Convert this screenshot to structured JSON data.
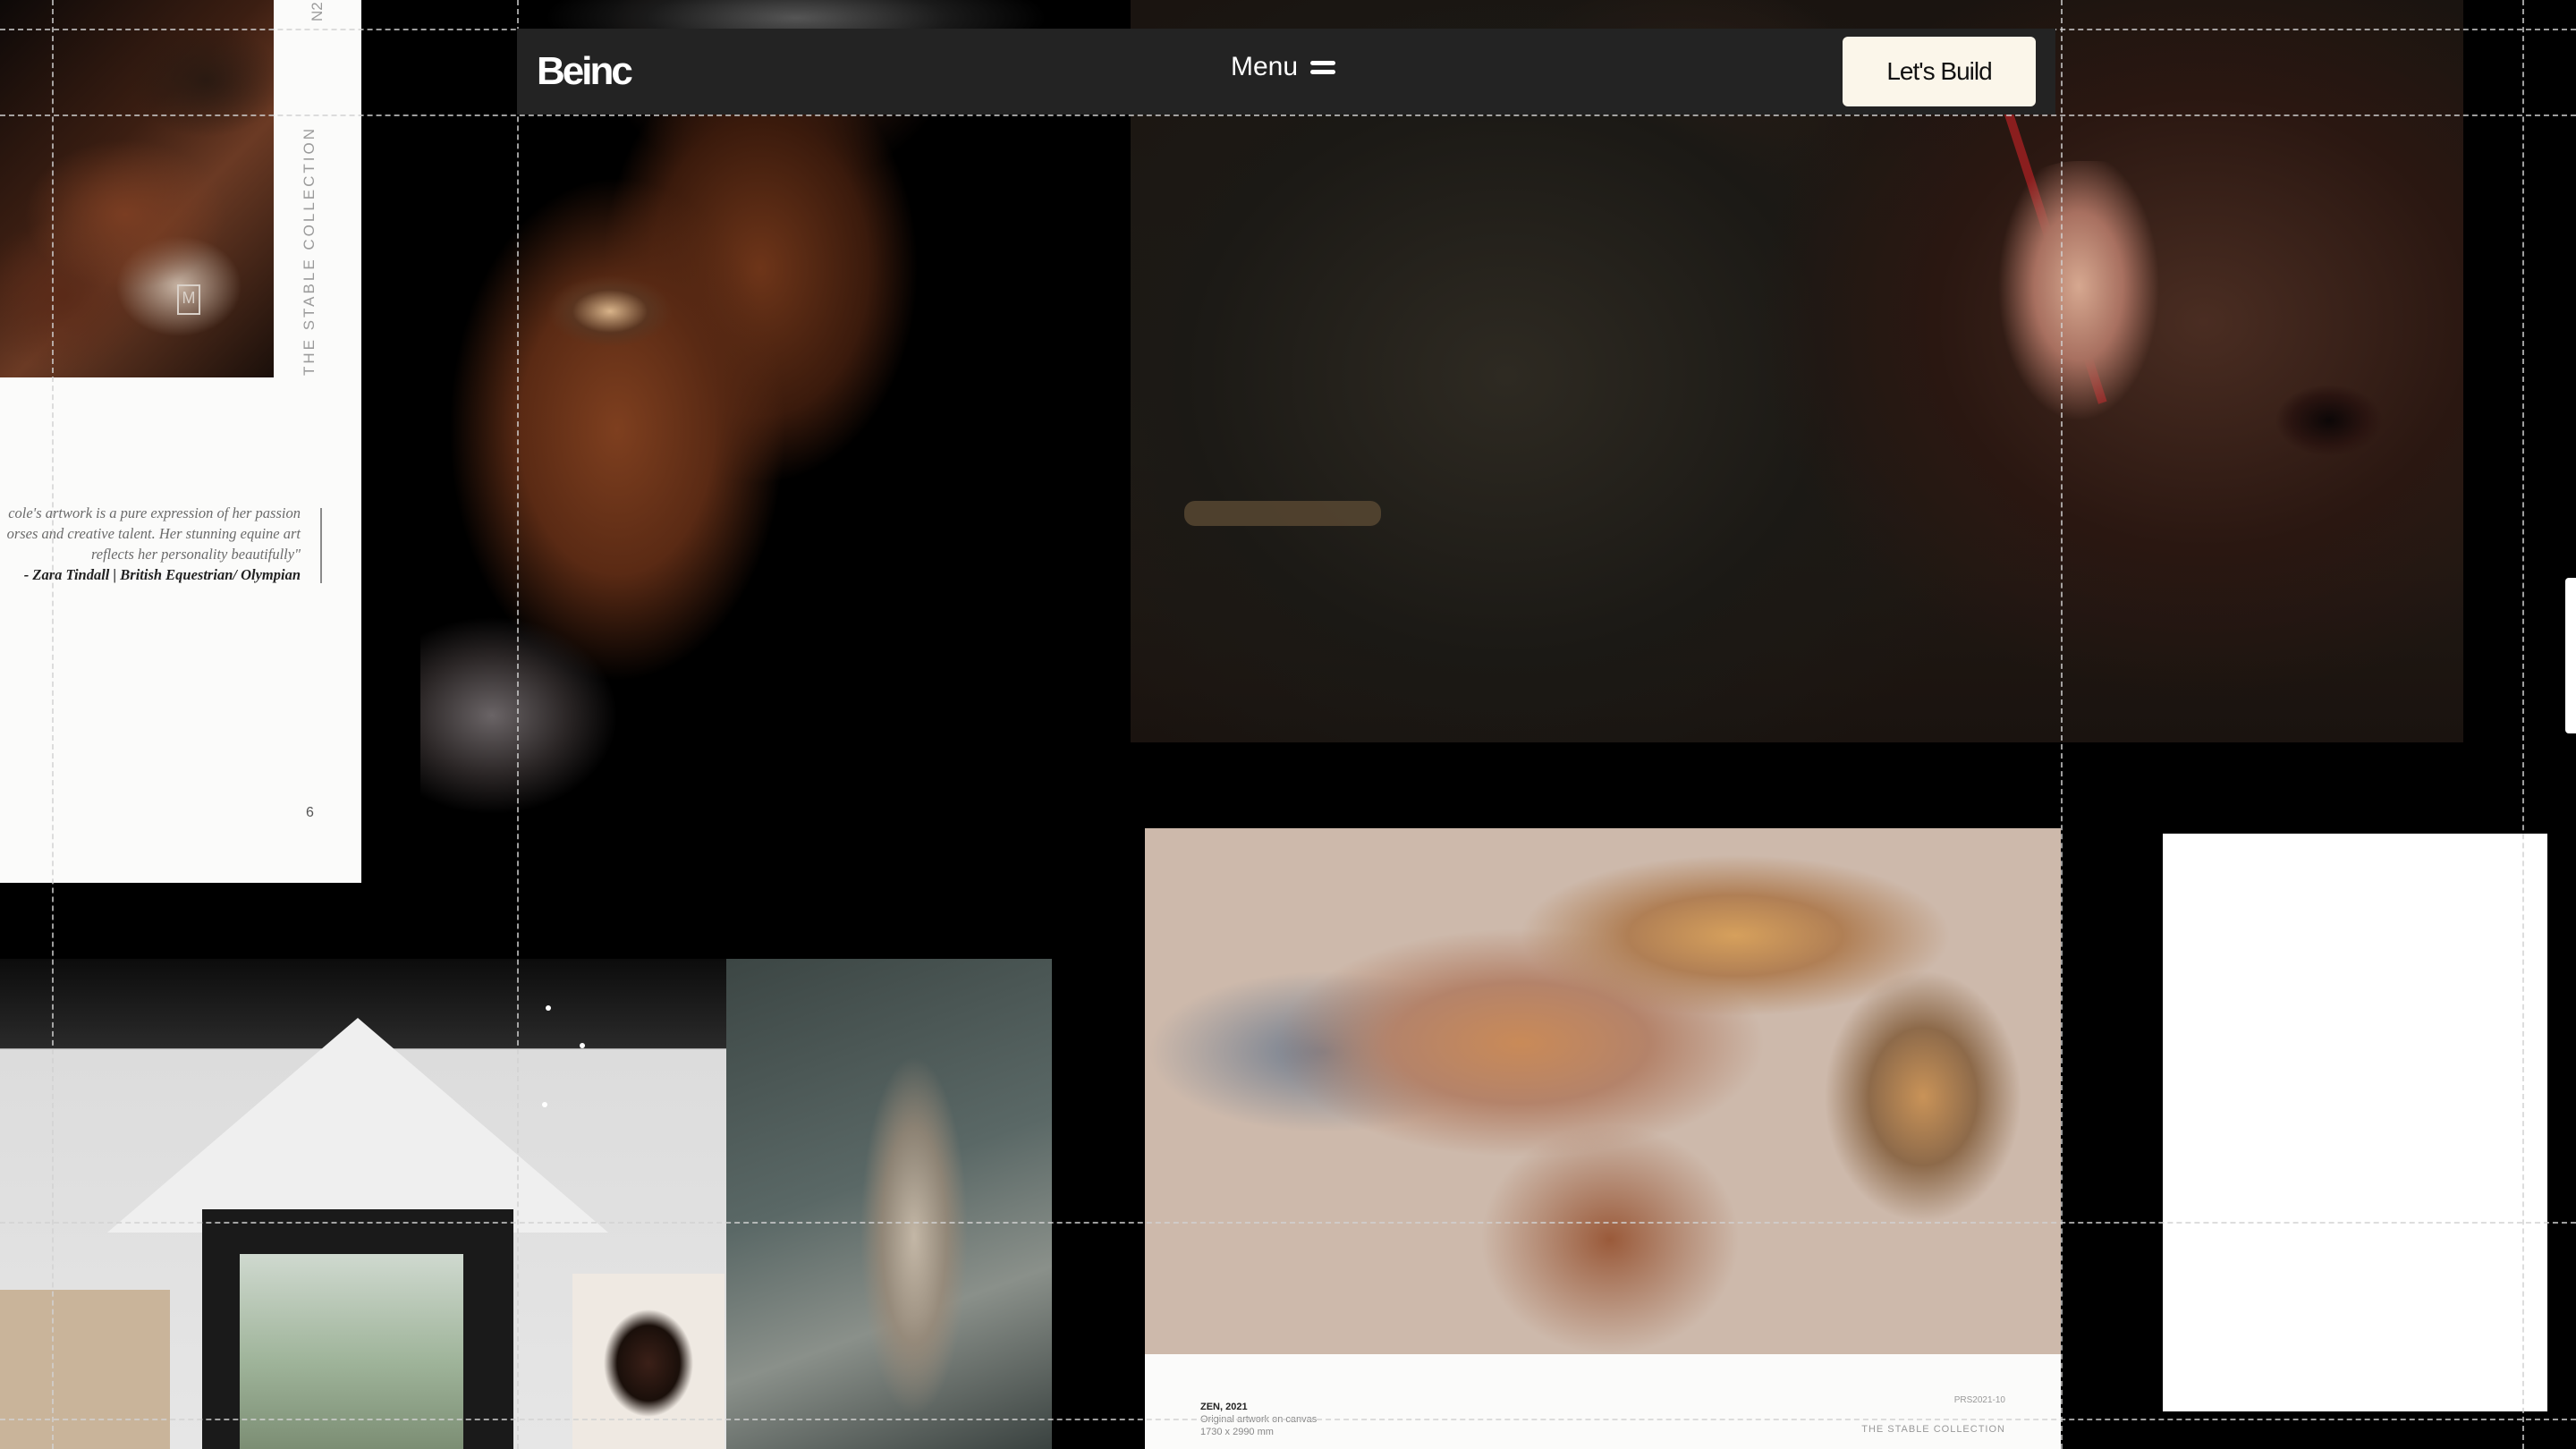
{
  "nav": {
    "logo": "Beinc",
    "menu_label": "Menu",
    "cta_label": "Let's Build"
  },
  "catalogue_page": {
    "side_label": "THE STABLE COLLECTION",
    "top_label": "N2",
    "quote_lines": [
      "cole's artwork is a pure expression of her passion",
      "orses and creative talent. Her stunning equine art",
      "reflects her personality beautifully\""
    ],
    "attribution": "- Zara Tindall | British Equestrian/ Olympian",
    "page_number": "6"
  },
  "zen_card": {
    "title": "ZEN, 2021",
    "meta_line1": "Original artwork on canvas",
    "meta_line2": "1730 x 2990 mm",
    "code": "PRS2021-10",
    "collection": "THE STABLE COLLECTION"
  },
  "colors": {
    "background": "#000000",
    "nav_bg": "#232323",
    "cta_bg": "#fbf6ea"
  }
}
